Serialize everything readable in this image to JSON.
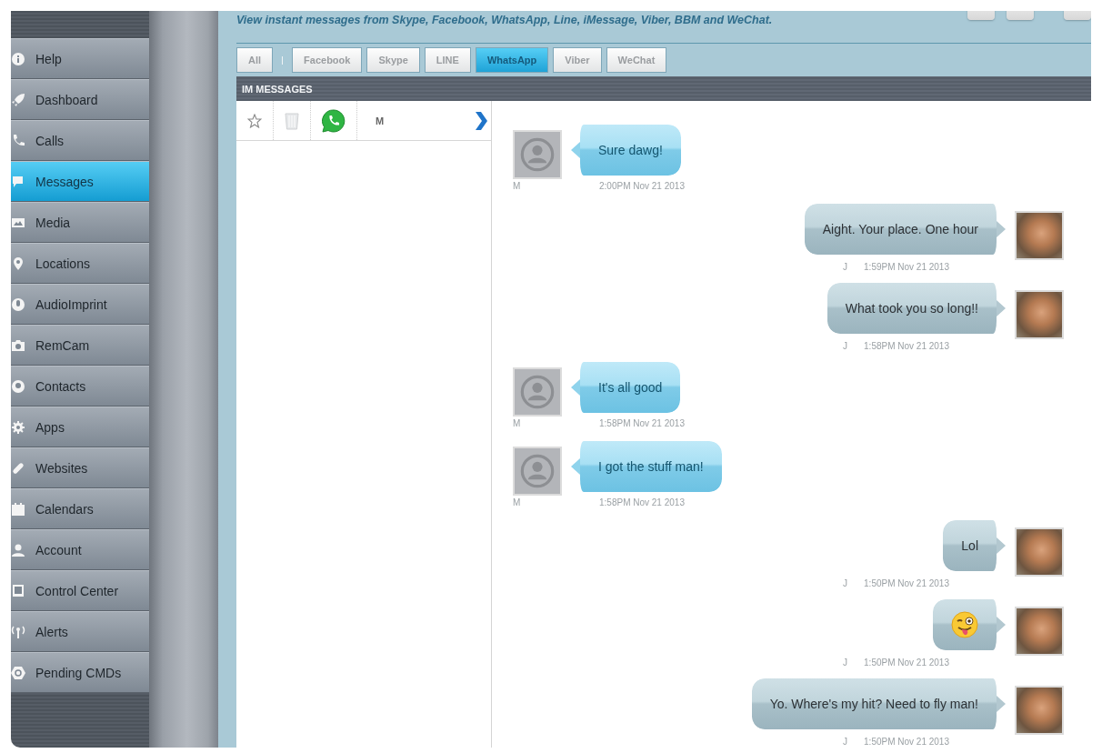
{
  "sidebar": {
    "items": [
      {
        "label": "Help",
        "selected": false
      },
      {
        "label": "Dashboard",
        "selected": false
      },
      {
        "label": "Calls",
        "selected": false
      },
      {
        "label": "Messages",
        "selected": true
      },
      {
        "label": "Media",
        "selected": false
      },
      {
        "label": "Locations",
        "selected": false
      },
      {
        "label": "AudioImprint",
        "selected": false
      },
      {
        "label": "RemCam",
        "selected": false
      },
      {
        "label": "Contacts",
        "selected": false
      },
      {
        "label": "Apps",
        "selected": false
      },
      {
        "label": "Websites",
        "selected": false
      },
      {
        "label": "Calendars",
        "selected": false
      },
      {
        "label": "Account",
        "selected": false
      },
      {
        "label": "Control Center",
        "selected": false
      },
      {
        "label": "Alerts",
        "selected": false
      },
      {
        "label": "Pending CMDs",
        "selected": false
      }
    ]
  },
  "header": {
    "subtitle": "View instant messages from Skype, Facebook, WhatsApp, Line, iMessage, Viber, BBM and WeChat."
  },
  "filter_tabs": [
    {
      "label": "All",
      "selected": false
    },
    {
      "label": "Facebook",
      "selected": false
    },
    {
      "label": "Skype",
      "selected": false
    },
    {
      "label": "LINE",
      "selected": false
    },
    {
      "label": "WhatsApp",
      "selected": true
    },
    {
      "label": "Viber",
      "selected": false
    },
    {
      "label": "WeChat",
      "selected": false
    }
  ],
  "panel_title": "IM MESSAGES",
  "conversations": [
    {
      "name": "M"
    }
  ],
  "messages": [
    {
      "outgoing": false,
      "kind": "text",
      "text": "Sure dawg!",
      "sender": "M",
      "time": "2:00PM Nov 21 2013"
    },
    {
      "outgoing": true,
      "kind": "text",
      "text": "Aight. Your place. One hour",
      "sender": "J",
      "time": "1:59PM Nov 21 2013"
    },
    {
      "outgoing": true,
      "kind": "text",
      "text": "What took you so long!!",
      "sender": "J",
      "time": "1:58PM Nov 21 2013"
    },
    {
      "outgoing": false,
      "kind": "text",
      "text": "It's all good",
      "sender": "M",
      "time": "1:58PM Nov 21 2013"
    },
    {
      "outgoing": false,
      "kind": "text",
      "text": "I got the stuff man!",
      "sender": "M",
      "time": "1:58PM Nov 21 2013"
    },
    {
      "outgoing": true,
      "kind": "text",
      "text": "Lol",
      "sender": "J",
      "time": "1:50PM Nov 21 2013"
    },
    {
      "outgoing": true,
      "kind": "emoji",
      "sender": "J",
      "time": "1:50PM Nov 21 2013"
    },
    {
      "outgoing": true,
      "kind": "text",
      "text": "Yo. Where's my hit? Need to fly man!",
      "sender": "J",
      "time": "1:50PM Nov 21 2013"
    }
  ]
}
